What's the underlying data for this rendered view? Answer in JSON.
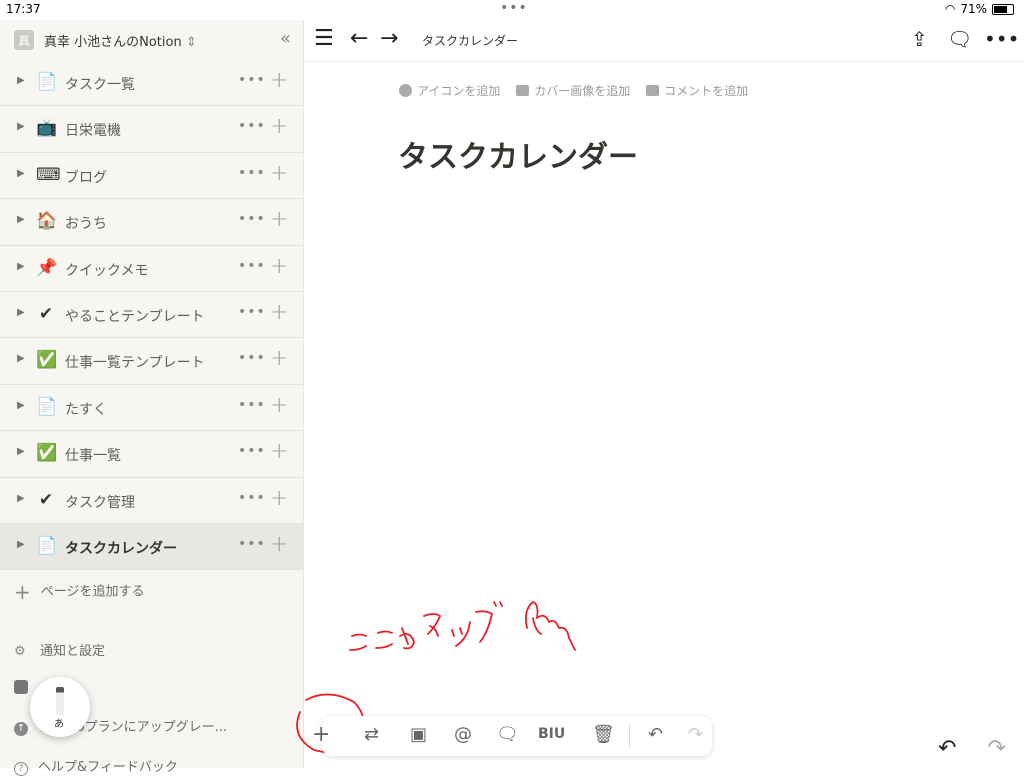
{
  "status": {
    "time": "17:37",
    "battery": "71%",
    "battery_level": 0.71
  },
  "workspace": {
    "avatar": "真",
    "name": "真幸 小池さんのNotion"
  },
  "pages": [
    {
      "label": "タスク一覧",
      "icon": "document-icon",
      "glyph": "📄"
    },
    {
      "label": "日栄電機",
      "icon": "tv-icon",
      "glyph": "📺"
    },
    {
      "label": "ブログ",
      "icon": "keyboard-icon",
      "glyph": "⌨"
    },
    {
      "label": "おうち",
      "icon": "house-icon",
      "glyph": "🏠"
    },
    {
      "label": "クイックメモ",
      "icon": "pushpin-icon",
      "glyph": "📌"
    },
    {
      "label": "やることテンプレート",
      "icon": "checkmark-icon",
      "glyph": "✔"
    },
    {
      "label": "仕事一覧テンプレート",
      "icon": "check-box-icon",
      "glyph": "✅"
    },
    {
      "label": "たすく",
      "icon": "document-icon",
      "glyph": "📄"
    },
    {
      "label": "仕事一覧",
      "icon": "check-box-icon",
      "glyph": "✅"
    },
    {
      "label": "タスク管理",
      "icon": "checkmark-icon",
      "glyph": "✔"
    },
    {
      "label": "タスクカレンダー",
      "icon": "document-icon",
      "glyph": "📄",
      "active": true
    }
  ],
  "sidebar_footer": {
    "add_page": "ページを追加する",
    "settings": "通知と設定",
    "upgrade": "ナルProプランにアップグレー...",
    "help": "ヘルプ&フィードバック"
  },
  "topbar": {
    "breadcrumb": "タスクカレンダー"
  },
  "page_actions": {
    "add_icon": "アイコンを追加",
    "add_cover": "カバー画像を追加",
    "add_comment": "コメントを追加"
  },
  "page": {
    "title": "タスクカレンダー"
  },
  "annotation": {
    "text": "ここをタップ",
    "color": "#e8202a"
  },
  "toolbar": {
    "format": "BIU",
    "mention": "@"
  }
}
